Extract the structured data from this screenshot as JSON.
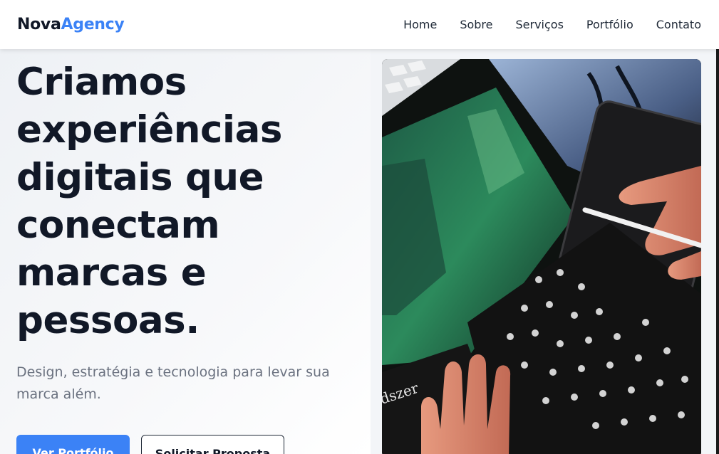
{
  "header": {
    "logo_part1": "Nova",
    "logo_part2": "Agency",
    "nav": [
      "Home",
      "Sobre",
      "Serviços",
      "Portfólio",
      "Contato"
    ]
  },
  "hero": {
    "headline_lines": [
      "Criamos",
      "experiências",
      "digitais que",
      "conectam",
      "marcas e",
      "pessoas."
    ],
    "subtitle_lines": [
      "Design, estratégia e tecnologia para levar sua",
      "marca além."
    ],
    "primary_button": "Ver Portfólio",
    "secondary_button": "Solicitar Proposta",
    "image_caption_text": "dszer"
  },
  "colors": {
    "accent": "#3b82f6",
    "headline": "#111827",
    "subtitle": "#6b7280"
  }
}
